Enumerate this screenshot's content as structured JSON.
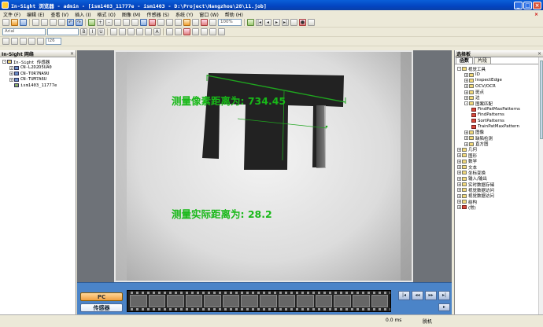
{
  "window": {
    "title": "In-Sight 浏览器 - admin - [ism1403_11777e - ism1403 - D:\\Project\\Hangzhou\\28\\11.job]"
  },
  "menu": [
    "文件 (F)",
    "编辑 (E)",
    "查看 (V)",
    "插入 (I)",
    "格式 (O)",
    "图像 (M)",
    "传感器 (S)",
    "系统 (Y)",
    "窗口 (W)",
    "帮助 (H)"
  ],
  "toolbar": {
    "zoom": "100%",
    "font": "Arial",
    "cell": "I26"
  },
  "network_panel": {
    "title": "In-Sight 网络",
    "items": [
      {
        "label": "In-Sight 传感器",
        "level": 0
      },
      {
        "label": "CN-L2D2D5UA0",
        "level": 1
      },
      {
        "label": "CN-TOR7NA9U",
        "level": 1
      },
      {
        "label": "CN-TUM7A6U",
        "level": 1
      },
      {
        "label": "ism1403_11777e",
        "level": 1
      }
    ]
  },
  "overlay": {
    "pixel_distance": "测量像素距离为: 734.45",
    "real_distance": "测量实际距离为: 28.2"
  },
  "filmstrip": {
    "pc_label": "PC",
    "sensor_label": "传感器"
  },
  "status": {
    "time": "0.0 ms",
    "mode": "脱机"
  },
  "palette": {
    "title": "选择板",
    "tabs": [
      "函数",
      "片段"
    ],
    "items": [
      {
        "label": "视觉工具",
        "level": 0
      },
      {
        "label": "ID",
        "level": 1
      },
      {
        "label": "InspectEdge",
        "level": 1
      },
      {
        "label": "OCV/OCR",
        "level": 1
      },
      {
        "label": "斑点",
        "level": 1
      },
      {
        "label": "边",
        "level": 1
      },
      {
        "label": "图案匹配",
        "level": 1
      },
      {
        "label": "FindPatMaxPatterns",
        "level": 2
      },
      {
        "label": "FindPatterns",
        "level": 2
      },
      {
        "label": "SortPatterns",
        "level": 2
      },
      {
        "label": "TrainPatMaxPattern",
        "level": 2
      },
      {
        "label": "图像",
        "level": 1
      },
      {
        "label": "缺陷检测",
        "level": 1
      },
      {
        "label": "直方图",
        "level": 1
      },
      {
        "label": "几何",
        "level": 0
      },
      {
        "label": "图形",
        "level": 0
      },
      {
        "label": "数学",
        "level": 0
      },
      {
        "label": "文本",
        "level": 0
      },
      {
        "label": "坐标变换",
        "level": 0
      },
      {
        "label": "输入/输出",
        "level": 0
      },
      {
        "label": "实时数据存储",
        "level": 0
      },
      {
        "label": "视觉数据访问",
        "level": 0
      },
      {
        "label": "视觉数据访问",
        "level": 0
      },
      {
        "label": "结构",
        "level": 0
      },
      {
        "label": "(常)",
        "level": 0
      }
    ]
  },
  "colors": {
    "overlay_text": "#18b818",
    "titlebar": "#0a5fd8",
    "filmbar": "#4b84c8"
  }
}
